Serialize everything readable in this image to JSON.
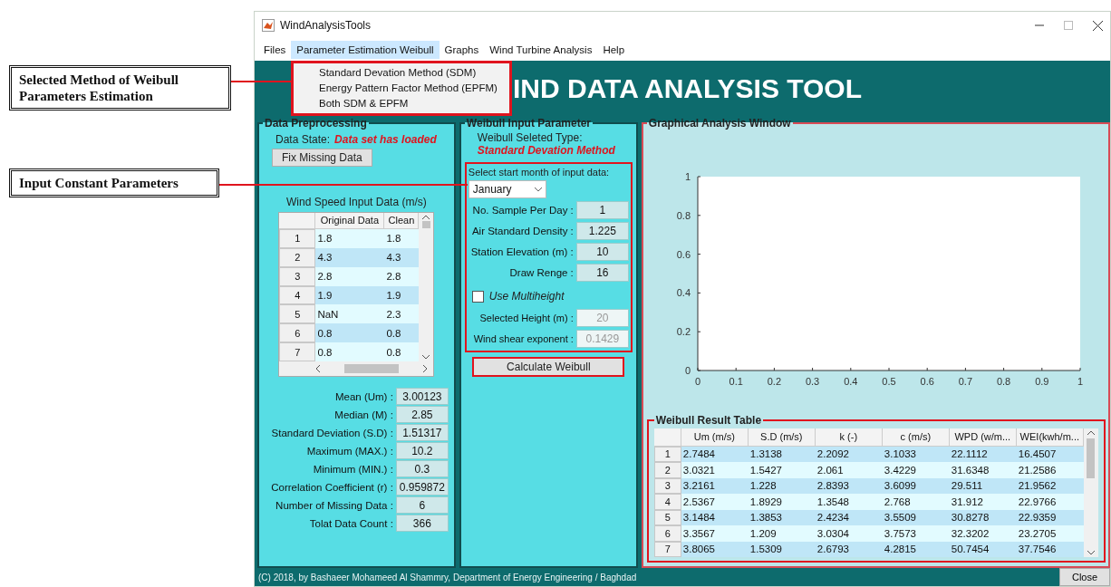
{
  "window": {
    "title": "WindAnalysisTools"
  },
  "menu_bar": [
    {
      "label": "Files",
      "selected": false
    },
    {
      "label": "Parameter Estimation Weibull",
      "selected": true
    },
    {
      "label": "Graphs",
      "selected": false
    },
    {
      "label": "Wind Turbine Analysis",
      "selected": false
    },
    {
      "label": "Help",
      "selected": false
    }
  ],
  "dropdown_menu": {
    "items": [
      "Standard Devation Method (SDM)",
      "Energy Pattern Factor Method (EPFM)",
      "Both SDM & EPFM"
    ]
  },
  "banner": {
    "title": "IND DATA ANALYSIS TOOL"
  },
  "data_panel": {
    "title": "Data Preprocessing",
    "state_label": "Data State:",
    "state_value": "Data set has loaded",
    "fix_button": "Fix Missing Data",
    "table_title": "Wind Speed Input Data (m/s)",
    "table": {
      "columns": [
        "Original Data",
        "Clean"
      ],
      "rows": [
        {
          "index": "1",
          "cells": [
            "1.8",
            "1.8"
          ]
        },
        {
          "index": "2",
          "cells": [
            "4.3",
            "4.3"
          ]
        },
        {
          "index": "3",
          "cells": [
            "2.8",
            "2.8"
          ]
        },
        {
          "index": "4",
          "cells": [
            "1.9",
            "1.9"
          ]
        },
        {
          "index": "5",
          "cells": [
            "NaN",
            "2.3"
          ]
        },
        {
          "index": "6",
          "cells": [
            "0.8",
            "0.8"
          ]
        },
        {
          "index": "7",
          "cells": [
            "0.8",
            "0.8"
          ]
        }
      ]
    },
    "stats": [
      {
        "label": "Mean (Um) :",
        "value": "3.00123"
      },
      {
        "label": "Median (M) :",
        "value": "2.85"
      },
      {
        "label": "Standard Deviation (S.D) :",
        "value": "1.51317"
      },
      {
        "label": "Maximum (MAX.) :",
        "value": "10.2"
      },
      {
        "label": "Minimum (MIN.) :",
        "value": "0.3"
      },
      {
        "label": "Correlation Coefficient (r) :",
        "value": "0.959872"
      },
      {
        "label": "Number of Missing Data :",
        "value": "6"
      },
      {
        "label": "Tolat Data Count :",
        "value": "366"
      }
    ]
  },
  "weibull_panel": {
    "title": "Weibull Input Parameter",
    "type_label": "Weibull Seleted Type:",
    "type_value": "Standard Devation Method",
    "month_label": "Select start month of input data:",
    "month": "January",
    "fields": [
      {
        "label": "No. Sample Per Day :",
        "value": "1",
        "disabled": false
      },
      {
        "label": "Air Standard Density :",
        "value": "1.225",
        "disabled": false
      },
      {
        "label": "Station Elevation (m) :",
        "value": "10",
        "disabled": false
      },
      {
        "label": "Draw Renge :",
        "value": "16",
        "disabled": false
      }
    ],
    "multiheight": {
      "label": "Use Multiheight",
      "checked": false
    },
    "height_fields": [
      {
        "label": "Selected Height (m) :",
        "value": "20",
        "disabled": true
      },
      {
        "label": "Wind shear exponent :",
        "value": "0.1429",
        "disabled": true
      }
    ],
    "calculate_button": "Calculate Weibull"
  },
  "graph_panel": {
    "title": "Graphical Analysis Window",
    "chart_data": {
      "type": "line",
      "xlim": [
        0,
        1
      ],
      "ylim": [
        0,
        1
      ],
      "xticks": [
        0,
        0.1,
        0.2,
        0.3,
        0.4,
        0.5,
        0.6,
        0.7,
        0.8,
        0.9,
        1
      ],
      "yticks": [
        0,
        0.2,
        0.4,
        0.6,
        0.8,
        1
      ]
    }
  },
  "result_table": {
    "title": "Weibull Result Table",
    "columns": [
      "Um (m/s)",
      "S.D (m/s)",
      "k (-)",
      "c (m/s)",
      "WPD (w/m...",
      "WEI(kwh/m..."
    ],
    "rows": [
      {
        "index": "1",
        "cells": [
          "2.7484",
          "1.3138",
          "2.2092",
          "3.1033",
          "22.1112",
          "16.4507"
        ]
      },
      {
        "index": "2",
        "cells": [
          "3.0321",
          "1.5427",
          "2.061",
          "3.4229",
          "31.6348",
          "21.2586"
        ]
      },
      {
        "index": "3",
        "cells": [
          "3.2161",
          "1.228",
          "2.8393",
          "3.6099",
          "29.511",
          "21.9562"
        ]
      },
      {
        "index": "4",
        "cells": [
          "2.5367",
          "1.8929",
          "1.3548",
          "2.768",
          "31.912",
          "22.9766"
        ]
      },
      {
        "index": "5",
        "cells": [
          "3.1484",
          "1.3853",
          "2.4234",
          "3.5509",
          "30.8278",
          "22.9359"
        ]
      },
      {
        "index": "6",
        "cells": [
          "3.3567",
          "1.209",
          "3.0304",
          "3.7573",
          "32.3202",
          "23.2705"
        ]
      },
      {
        "index": "7",
        "cells": [
          "3.8065",
          "1.5309",
          "2.6793",
          "4.2815",
          "50.7454",
          "37.7546"
        ]
      }
    ]
  },
  "status_bar": {
    "text": "(C) 2018, by  Bashaeer Mohameed Al Shammry, Department of Energy Engineering / Baghdad",
    "close_button": "Close"
  },
  "annotations": [
    {
      "text": "Selected Method of Weibull Parameters Estimation"
    },
    {
      "text": "Input Constant Parameters"
    }
  ]
}
